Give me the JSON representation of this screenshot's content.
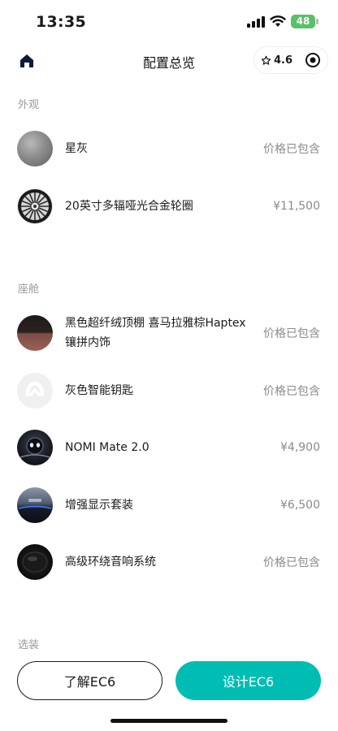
{
  "status_bar": {
    "time": "13:35",
    "battery": "48"
  },
  "nav": {
    "title": "配置总览",
    "rating": "4.6"
  },
  "sections": [
    {
      "title": "外观",
      "items": [
        {
          "name": "星灰",
          "price": "价格已包含",
          "thumb": "grey-paint"
        },
        {
          "name": "20英寸多辐哑光合金轮圈",
          "price": "¥11,500",
          "thumb": "alloy-wheel"
        }
      ]
    },
    {
      "title": "座舱",
      "items": [
        {
          "name": "黑色超纤绒顶棚 喜马拉雅棕Haptex镶拼内饰",
          "price": "价格已包含",
          "thumb": "interior"
        },
        {
          "name": "灰色智能钥匙",
          "price": "价格已包含",
          "thumb": "smart-key"
        },
        {
          "name": "NOMI Mate 2.0",
          "price": "¥4,900",
          "thumb": "nomi"
        },
        {
          "name": "增强显示套装",
          "price": "¥6,500",
          "thumb": "display"
        },
        {
          "name": "高级环绕音响系统",
          "price": "价格已包含",
          "thumb": "speaker"
        }
      ]
    },
    {
      "title": "选装"
    }
  ],
  "buttons": {
    "learn": "了解EC6",
    "design": "设计EC6"
  },
  "colors": {
    "accent": "#00bdb4",
    "text": "#1a1a1a",
    "muted": "#8a8a8a"
  }
}
